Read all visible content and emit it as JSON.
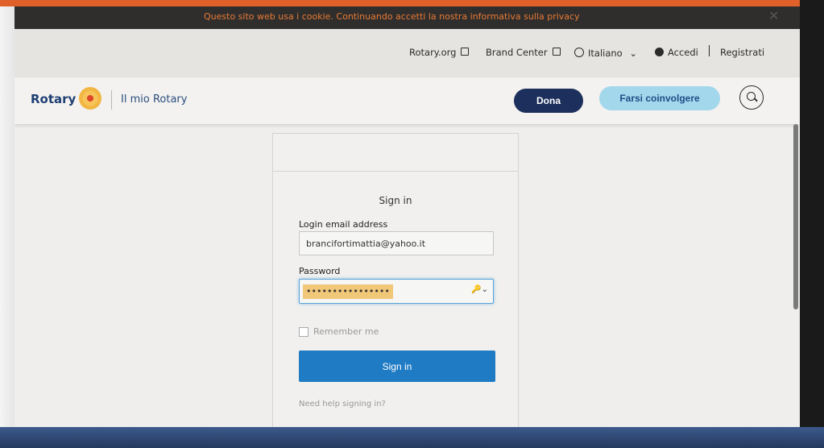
{
  "cookie_banner": {
    "text": "Questo sito web usa i cookie. Continuando accetti la nostra informativa sulla privacy",
    "close": "✕"
  },
  "top_links": {
    "rotary_org": "Rotary.org",
    "brand_center": "Brand Center",
    "language": "Italiano",
    "language_chevron": "⌄",
    "login": "Accedi",
    "register": "Registrati"
  },
  "header": {
    "logo_text": "Rotary",
    "section": "Il mio Rotary",
    "donate": "Dona",
    "get_involved": "Farsi coinvolgere"
  },
  "login": {
    "title": "Sign in",
    "email_label": "Login email address",
    "email_value": "brancifortimattia@yahoo.it",
    "password_label": "Password",
    "password_value": "••••••••••••••••",
    "key_icon": "🔑⌄",
    "remember_label": "Remember me",
    "submit": "Sign in",
    "help": "Need help signing in?"
  },
  "colors": {
    "accent_orange": "#e97a35",
    "navy": "#1d2f5c",
    "light_blue": "#a3d7ec",
    "button_blue": "#1f7bc4"
  },
  "icons": [
    "external-link-icon",
    "globe-icon",
    "chevron-down-icon",
    "user-icon",
    "search-icon",
    "key-icon",
    "close-icon"
  ]
}
